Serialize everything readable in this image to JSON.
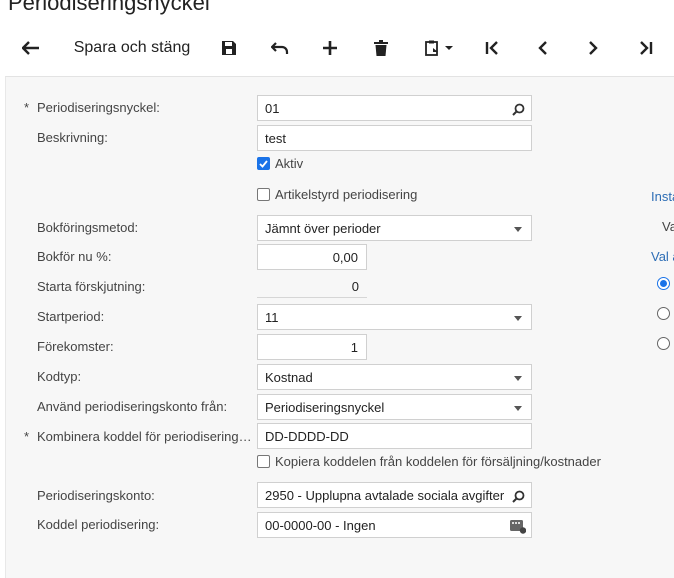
{
  "page": {
    "title": "Periodiseringsnyckel"
  },
  "toolbar": {
    "back_icon": "arrow-left-icon",
    "save_close_label": "Spara och stäng",
    "save_icon": "floppy-disk-icon",
    "undo_icon": "undo-icon",
    "add_icon": "plus-icon",
    "delete_icon": "trash-icon",
    "clipboard_icon": "clipboard-dropdown-icon",
    "first_icon": "first-record-icon",
    "prev_icon": "previous-record-icon",
    "next_icon": "next-record-icon",
    "last_icon": "last-record-icon"
  },
  "form": {
    "key": {
      "label": "Periodiseringsnyckel:",
      "value": "01",
      "required": "*"
    },
    "description": {
      "label": "Beskrivning:",
      "value": "test"
    },
    "active": {
      "label": "Aktiv",
      "checked": true
    },
    "item_based": {
      "label": "Artikelstyrd periodisering",
      "checked": false
    },
    "method": {
      "label": "Bokföringsmetod:",
      "value": "Jämnt över perioder"
    },
    "post_now": {
      "label": "Bokför nu %:",
      "value": "0,00"
    },
    "start_offset": {
      "label": "Starta förskjutning:",
      "value": "0"
    },
    "start_period": {
      "label": "Startperiod:",
      "value": "11"
    },
    "occurrences": {
      "label": "Förekomster:",
      "value": "1"
    },
    "code_type": {
      "label": "Kodtyp:",
      "value": "Kostnad"
    },
    "account_from": {
      "label": "Använd periodiseringskonto från:",
      "value": "Periodiseringsnyckel"
    },
    "combine_subaccount": {
      "label": "Kombinera koddel för periodisering…",
      "value": "DD-DDDD-DD",
      "required": "*"
    },
    "copy_subaccount": {
      "label": "Kopiera koddelen från koddelen för försäljning/kostnader",
      "checked": false
    },
    "deferral_account": {
      "label": "Periodiseringskonto:",
      "value": "2950 - Upplupna avtalade sociala avgifter"
    },
    "deferral_subaccount": {
      "label": "Koddel periodisering:",
      "value": "00-0000-00 - Ingen"
    }
  },
  "side": {
    "link1": "Insta",
    "text1": "Va",
    "link2": "Val a"
  },
  "colors": {
    "accent": "#1a73e8",
    "link": "#2d6db5",
    "panel": "#f7f7f7"
  }
}
